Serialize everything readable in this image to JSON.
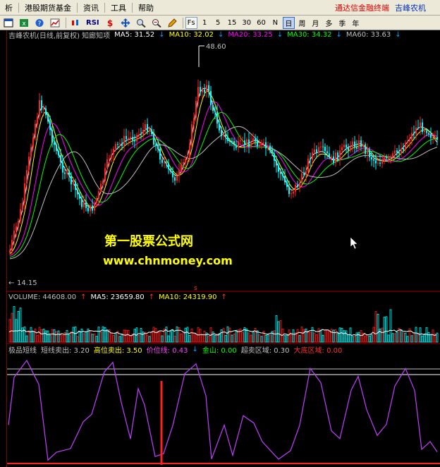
{
  "menu": {
    "items": [
      "析",
      "港股期货基金",
      "资讯",
      "工具",
      "帮助"
    ],
    "right_brand": "通达信金融终端",
    "right_stock": "吉峰农机"
  },
  "toolbar": {
    "rsi_label": "RSI",
    "fs_label": "Fs",
    "periods": [
      "1",
      "5",
      "15",
      "30",
      "60",
      "N",
      "日",
      "周",
      "月",
      "多",
      "季",
      "年"
    ],
    "active_period": "日"
  },
  "main_legend": {
    "title": "吉峰农机(日线,前复权) 知廊知项",
    "ma5": "MA5: 31.52",
    "ma10": "MA10: 32.02",
    "ma20": "MA20: 33.25",
    "ma30": "MA30: 34.32",
    "ma60": "MA60: 33.63"
  },
  "price_labels": {
    "high": "48.60",
    "low": "14.15"
  },
  "volume_legend": {
    "volume": "VOLUME: 44608.00",
    "ma5": "MA5: 23659.80",
    "ma10": "MA10: 24319.90"
  },
  "indicator_legend": {
    "name": "极品短线",
    "short_sell": "短线卖出: 3.20",
    "high_sell": "高位卖出: 3.50",
    "price_line": "价位线: 0.43",
    "gold_mountain": "金山: 0.00",
    "oversold_zone": "超卖区域: 0.30",
    "bottom_zone": "大底区域: 0.00"
  },
  "watermark": {
    "title": "第一股票公式网",
    "url": "www.chnmoney.com"
  },
  "colors": {
    "up": "#ff2020",
    "down": "#00ffff",
    "ma5": "#ffffff",
    "ma10": "#ffff00",
    "ma20": "#ff00ff",
    "ma30": "#00ff00",
    "ma60": "#c0c0c0",
    "indicator": "#c040ff",
    "watermark": "#ffff00"
  }
}
